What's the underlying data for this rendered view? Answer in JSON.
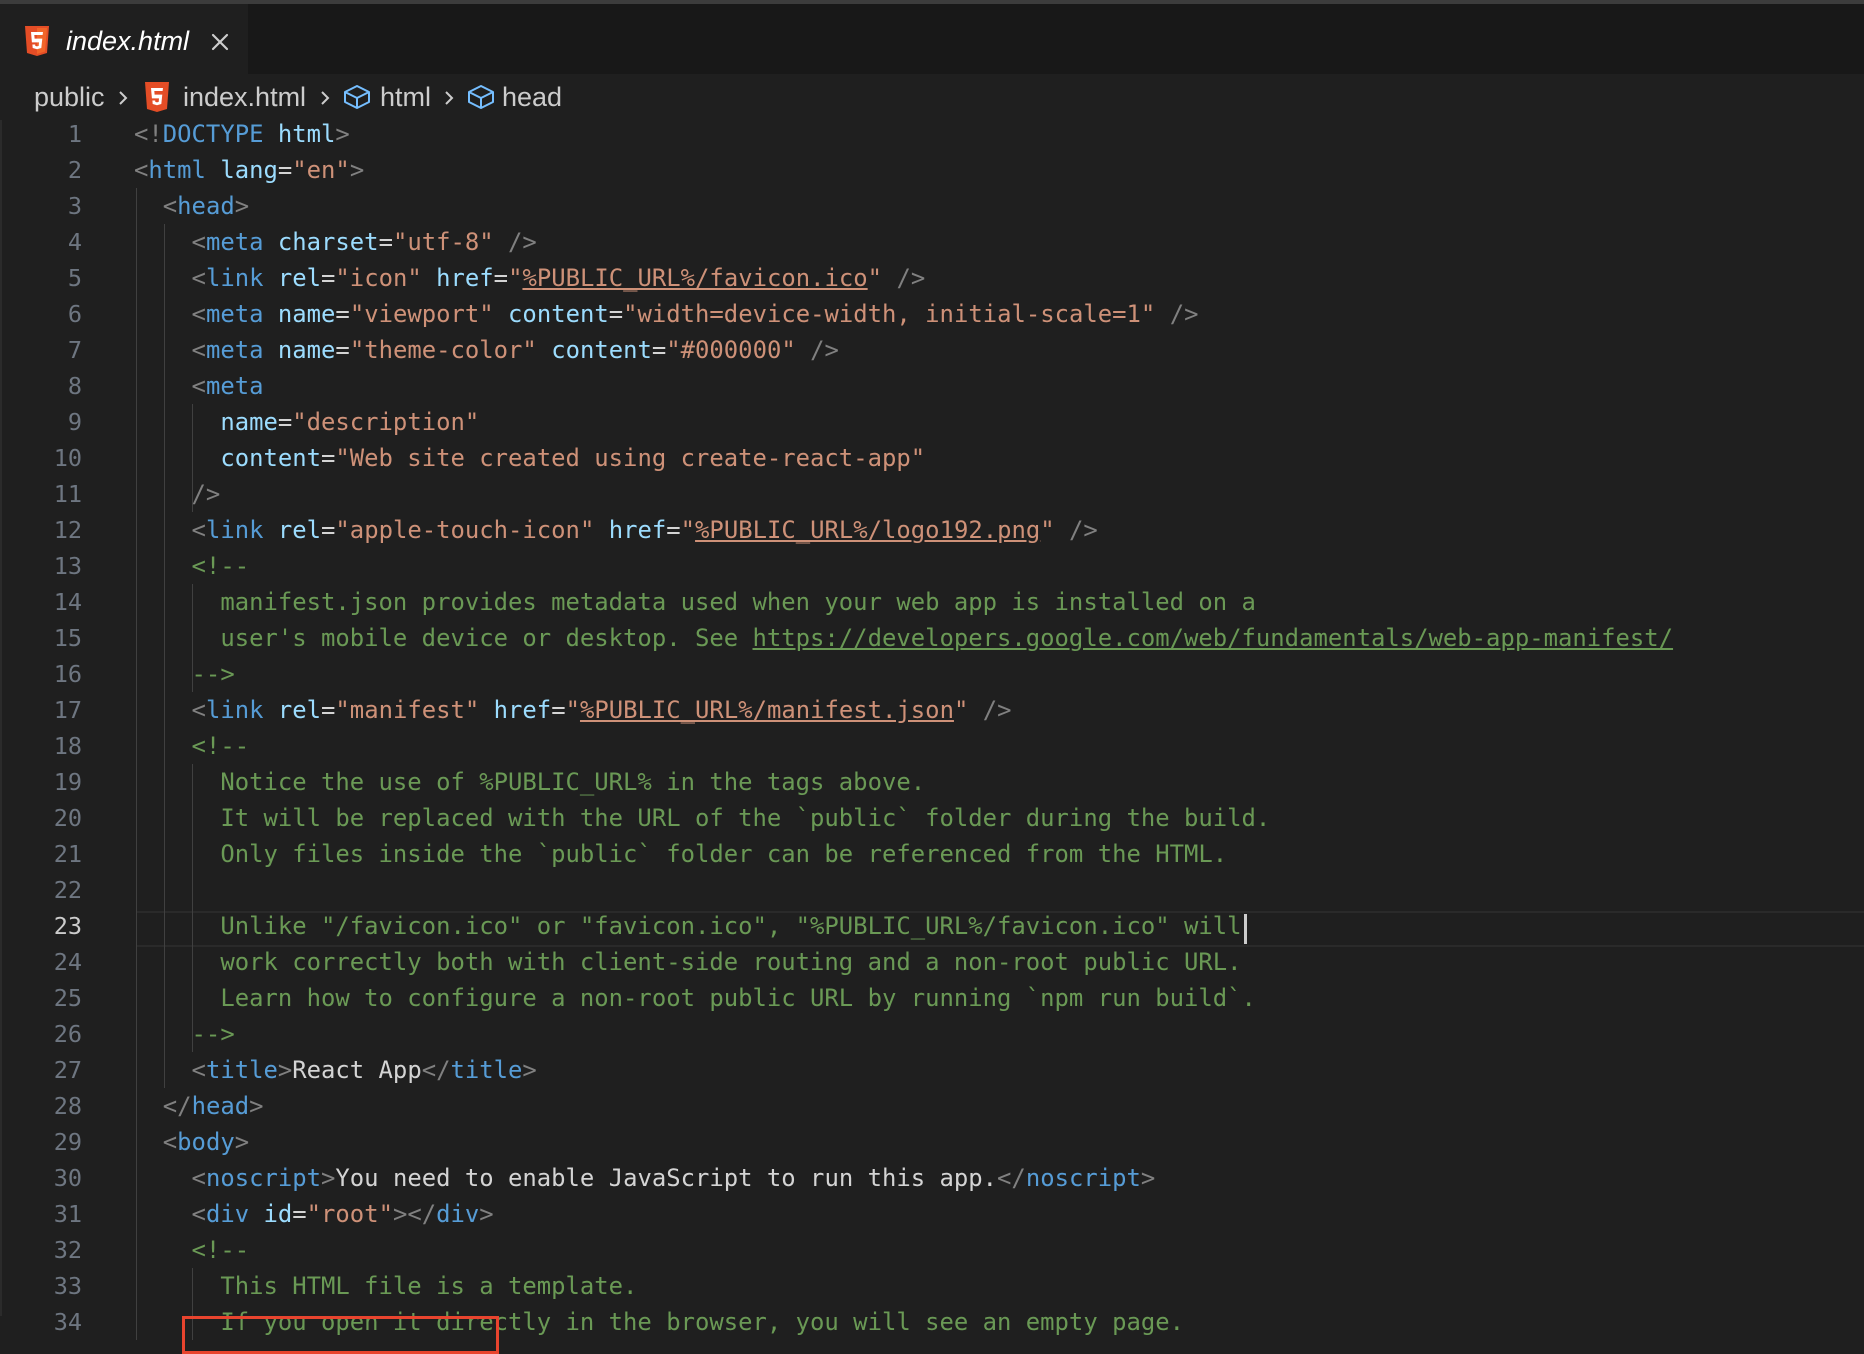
{
  "tab": {
    "filename": "index.html",
    "file_icon": "html5-icon",
    "close_icon": "close-icon"
  },
  "breadcrumb": {
    "items": [
      {
        "label": "public",
        "icon": ""
      },
      {
        "label": "index.html",
        "icon": "html5-icon"
      },
      {
        "label": "html",
        "icon": "symbol-field-icon"
      },
      {
        "label": "head",
        "icon": "symbol-field-icon"
      }
    ],
    "separator_icon": "chevron-right-icon"
  },
  "editor": {
    "active_line": 23,
    "highlighted_line": 31,
    "line_numbers": [
      "1",
      "2",
      "3",
      "4",
      "5",
      "6",
      "7",
      "8",
      "9",
      "10",
      "11",
      "12",
      "13",
      "14",
      "15",
      "16",
      "17",
      "18",
      "19",
      "20",
      "21",
      "22",
      "23",
      "24",
      "25",
      "26",
      "27",
      "28",
      "29",
      "30",
      "31",
      "32",
      "33",
      "34"
    ],
    "lines": [
      [
        [
          "b",
          "<!"
        ],
        [
          "tag",
          "DOCTYPE"
        ],
        [
          "w",
          " "
        ],
        [
          "attr",
          "html"
        ],
        [
          "b",
          ">"
        ]
      ],
      [
        [
          "b",
          "<"
        ],
        [
          "tag",
          "html"
        ],
        [
          "w",
          " "
        ],
        [
          "attr",
          "lang"
        ],
        [
          "w",
          "="
        ],
        [
          "str",
          "\"en\""
        ],
        [
          "b",
          ">"
        ]
      ],
      [
        [
          "w",
          "  "
        ],
        [
          "b",
          "<"
        ],
        [
          "tag",
          "head"
        ],
        [
          "b",
          ">"
        ]
      ],
      [
        [
          "w",
          "    "
        ],
        [
          "b",
          "<"
        ],
        [
          "tag",
          "meta"
        ],
        [
          "w",
          " "
        ],
        [
          "attr",
          "charset"
        ],
        [
          "w",
          "="
        ],
        [
          "str",
          "\"utf-8\""
        ],
        [
          "w",
          " "
        ],
        [
          "b",
          "/>"
        ]
      ],
      [
        [
          "w",
          "    "
        ],
        [
          "b",
          "<"
        ],
        [
          "tag",
          "link"
        ],
        [
          "w",
          " "
        ],
        [
          "attr",
          "rel"
        ],
        [
          "w",
          "="
        ],
        [
          "str",
          "\"icon\""
        ],
        [
          "w",
          " "
        ],
        [
          "attr",
          "href"
        ],
        [
          "w",
          "="
        ],
        [
          "str",
          "\""
        ],
        [
          "strl",
          "%PUBLIC_URL%/favicon.ico"
        ],
        [
          "str",
          "\""
        ],
        [
          "w",
          " "
        ],
        [
          "b",
          "/>"
        ]
      ],
      [
        [
          "w",
          "    "
        ],
        [
          "b",
          "<"
        ],
        [
          "tag",
          "meta"
        ],
        [
          "w",
          " "
        ],
        [
          "attr",
          "name"
        ],
        [
          "w",
          "="
        ],
        [
          "str",
          "\"viewport\""
        ],
        [
          "w",
          " "
        ],
        [
          "attr",
          "content"
        ],
        [
          "w",
          "="
        ],
        [
          "str",
          "\"width=device-width, initial-scale=1\""
        ],
        [
          "w",
          " "
        ],
        [
          "b",
          "/>"
        ]
      ],
      [
        [
          "w",
          "    "
        ],
        [
          "b",
          "<"
        ],
        [
          "tag",
          "meta"
        ],
        [
          "w",
          " "
        ],
        [
          "attr",
          "name"
        ],
        [
          "w",
          "="
        ],
        [
          "str",
          "\"theme-color\""
        ],
        [
          "w",
          " "
        ],
        [
          "attr",
          "content"
        ],
        [
          "w",
          "="
        ],
        [
          "str",
          "\"#000000\""
        ],
        [
          "w",
          " "
        ],
        [
          "b",
          "/>"
        ]
      ],
      [
        [
          "w",
          "    "
        ],
        [
          "b",
          "<"
        ],
        [
          "tag",
          "meta"
        ]
      ],
      [
        [
          "w",
          "      "
        ],
        [
          "attr",
          "name"
        ],
        [
          "w",
          "="
        ],
        [
          "str",
          "\"description\""
        ]
      ],
      [
        [
          "w",
          "      "
        ],
        [
          "attr",
          "content"
        ],
        [
          "w",
          "="
        ],
        [
          "str",
          "\"Web site created using create-react-app\""
        ]
      ],
      [
        [
          "w",
          "    "
        ],
        [
          "b",
          "/>"
        ]
      ],
      [
        [
          "w",
          "    "
        ],
        [
          "b",
          "<"
        ],
        [
          "tag",
          "link"
        ],
        [
          "w",
          " "
        ],
        [
          "attr",
          "rel"
        ],
        [
          "w",
          "="
        ],
        [
          "str",
          "\"apple-touch-icon\""
        ],
        [
          "w",
          " "
        ],
        [
          "attr",
          "href"
        ],
        [
          "w",
          "="
        ],
        [
          "str",
          "\""
        ],
        [
          "strl",
          "%PUBLIC_URL%/logo192.png"
        ],
        [
          "str",
          "\""
        ],
        [
          "w",
          " "
        ],
        [
          "b",
          "/>"
        ]
      ],
      [
        [
          "w",
          "    "
        ],
        [
          "cm",
          "<!--"
        ]
      ],
      [
        [
          "w",
          "      "
        ],
        [
          "cm",
          "manifest.json provides metadata used when your web app is installed on a"
        ]
      ],
      [
        [
          "w",
          "      "
        ],
        [
          "cm",
          "user's mobile device or desktop. See "
        ],
        [
          "cml",
          "https://developers.google.com/web/fundamentals/web-app-manifest/"
        ]
      ],
      [
        [
          "w",
          "    "
        ],
        [
          "cm",
          "-->"
        ]
      ],
      [
        [
          "w",
          "    "
        ],
        [
          "b",
          "<"
        ],
        [
          "tag",
          "link"
        ],
        [
          "w",
          " "
        ],
        [
          "attr",
          "rel"
        ],
        [
          "w",
          "="
        ],
        [
          "str",
          "\"manifest\""
        ],
        [
          "w",
          " "
        ],
        [
          "attr",
          "href"
        ],
        [
          "w",
          "="
        ],
        [
          "str",
          "\""
        ],
        [
          "strl",
          "%PUBLIC_URL%/manifest.json"
        ],
        [
          "str",
          "\""
        ],
        [
          "w",
          " "
        ],
        [
          "b",
          "/>"
        ]
      ],
      [
        [
          "w",
          "    "
        ],
        [
          "cm",
          "<!--"
        ]
      ],
      [
        [
          "w",
          "      "
        ],
        [
          "cm",
          "Notice the use of %PUBLIC_URL% in the tags above."
        ]
      ],
      [
        [
          "w",
          "      "
        ],
        [
          "cm",
          "It will be replaced with the URL of the `public` folder during the build."
        ]
      ],
      [
        [
          "w",
          "      "
        ],
        [
          "cm",
          "Only files inside the `public` folder can be referenced from the HTML."
        ]
      ],
      [],
      [
        [
          "w",
          "      "
        ],
        [
          "cm",
          "Unlike \"/favicon.ico\" or \"favicon.ico\", \"%PUBLIC_URL%/favicon.ico\" will"
        ]
      ],
      [
        [
          "w",
          "      "
        ],
        [
          "cm",
          "work correctly both with client-side routing and a non-root public URL."
        ]
      ],
      [
        [
          "w",
          "      "
        ],
        [
          "cm",
          "Learn how to configure a non-root public URL by running `npm run build`."
        ]
      ],
      [
        [
          "w",
          "    "
        ],
        [
          "cm",
          "-->"
        ]
      ],
      [
        [
          "w",
          "    "
        ],
        [
          "b",
          "<"
        ],
        [
          "tag",
          "title"
        ],
        [
          "b",
          ">"
        ],
        [
          "txt",
          "React App"
        ],
        [
          "b",
          "</"
        ],
        [
          "tag",
          "title"
        ],
        [
          "b",
          ">"
        ]
      ],
      [
        [
          "w",
          "  "
        ],
        [
          "b",
          "</"
        ],
        [
          "tag",
          "head"
        ],
        [
          "b",
          ">"
        ]
      ],
      [
        [
          "w",
          "  "
        ],
        [
          "b",
          "<"
        ],
        [
          "tag",
          "body"
        ],
        [
          "b",
          ">"
        ]
      ],
      [
        [
          "w",
          "    "
        ],
        [
          "b",
          "<"
        ],
        [
          "tag",
          "noscript"
        ],
        [
          "b",
          ">"
        ],
        [
          "txt",
          "You need to enable JavaScript to run this app."
        ],
        [
          "b",
          "</"
        ],
        [
          "tag",
          "noscript"
        ],
        [
          "b",
          ">"
        ]
      ],
      [
        [
          "w",
          "    "
        ],
        [
          "b",
          "<"
        ],
        [
          "tag",
          "div"
        ],
        [
          "w",
          " "
        ],
        [
          "attr",
          "id"
        ],
        [
          "w",
          "="
        ],
        [
          "str",
          "\"root\""
        ],
        [
          "b",
          "></"
        ],
        [
          "tag",
          "div"
        ],
        [
          "b",
          ">"
        ]
      ],
      [
        [
          "w",
          "    "
        ],
        [
          "cm",
          "<!--"
        ]
      ],
      [
        [
          "w",
          "      "
        ],
        [
          "cm",
          "This HTML file is a template."
        ]
      ],
      [
        [
          "w",
          "      "
        ],
        [
          "cm",
          "If you open it directly in the browser, you will see an empty page."
        ]
      ]
    ]
  },
  "colors": {
    "editor_bg": "#1f1f1f",
    "tag": "#569cd6",
    "attribute": "#9cdcfe",
    "string": "#ce9178",
    "comment": "#6a9955",
    "bracket": "#808080",
    "highlight_box": "#e8442e",
    "html5_icon": "#e44d26"
  }
}
